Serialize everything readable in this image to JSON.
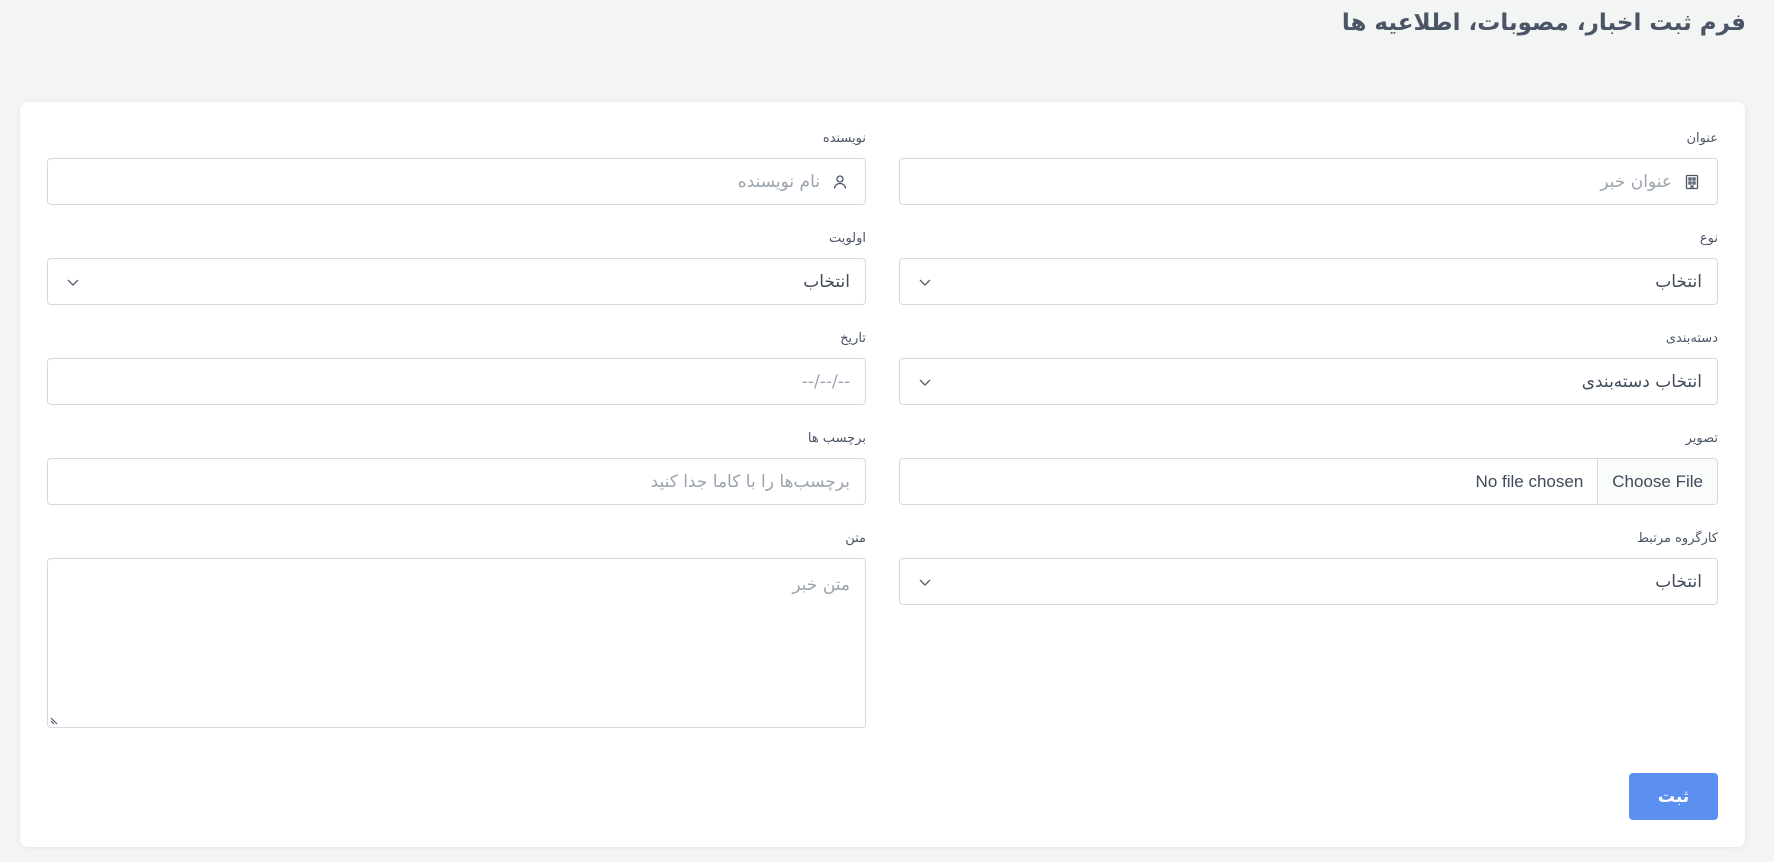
{
  "page_title": "فرم ثبت اخبار، مصوبات، اطلاعیه ها",
  "form": {
    "title_field": {
      "label": "عنوان",
      "placeholder": "عنوان خبر",
      "icon": "building-icon"
    },
    "author_field": {
      "label": "نویسنده",
      "placeholder": "نام نویسنده",
      "icon": "user-icon"
    },
    "type_field": {
      "label": "نوع",
      "selected": "انتخاب"
    },
    "priority_field": {
      "label": "اولویت",
      "selected": "انتخاب"
    },
    "category_field": {
      "label": "دسته‌بندی",
      "selected": "انتخاب دسته‌بندی"
    },
    "date_field": {
      "label": "تاریخ",
      "placeholder": "--/--/--"
    },
    "image_field": {
      "label": "تصویر",
      "button_label": "Choose File",
      "status": "No file chosen"
    },
    "tags_field": {
      "label": "برچسب ها",
      "placeholder": "برچسب‌ها را با کاما جدا کنید"
    },
    "workgroup_field": {
      "label": "کارگروه مرتبط",
      "selected": "انتخاب"
    },
    "body_field": {
      "label": "متن",
      "placeholder": "متن خبر"
    },
    "submit_label": "ثبت"
  },
  "colors": {
    "accent": "#5b8ff0",
    "background": "#f3f4f4",
    "card": "#ffffff",
    "border": "#d5d9de",
    "placeholder": "#9aa3ae"
  }
}
